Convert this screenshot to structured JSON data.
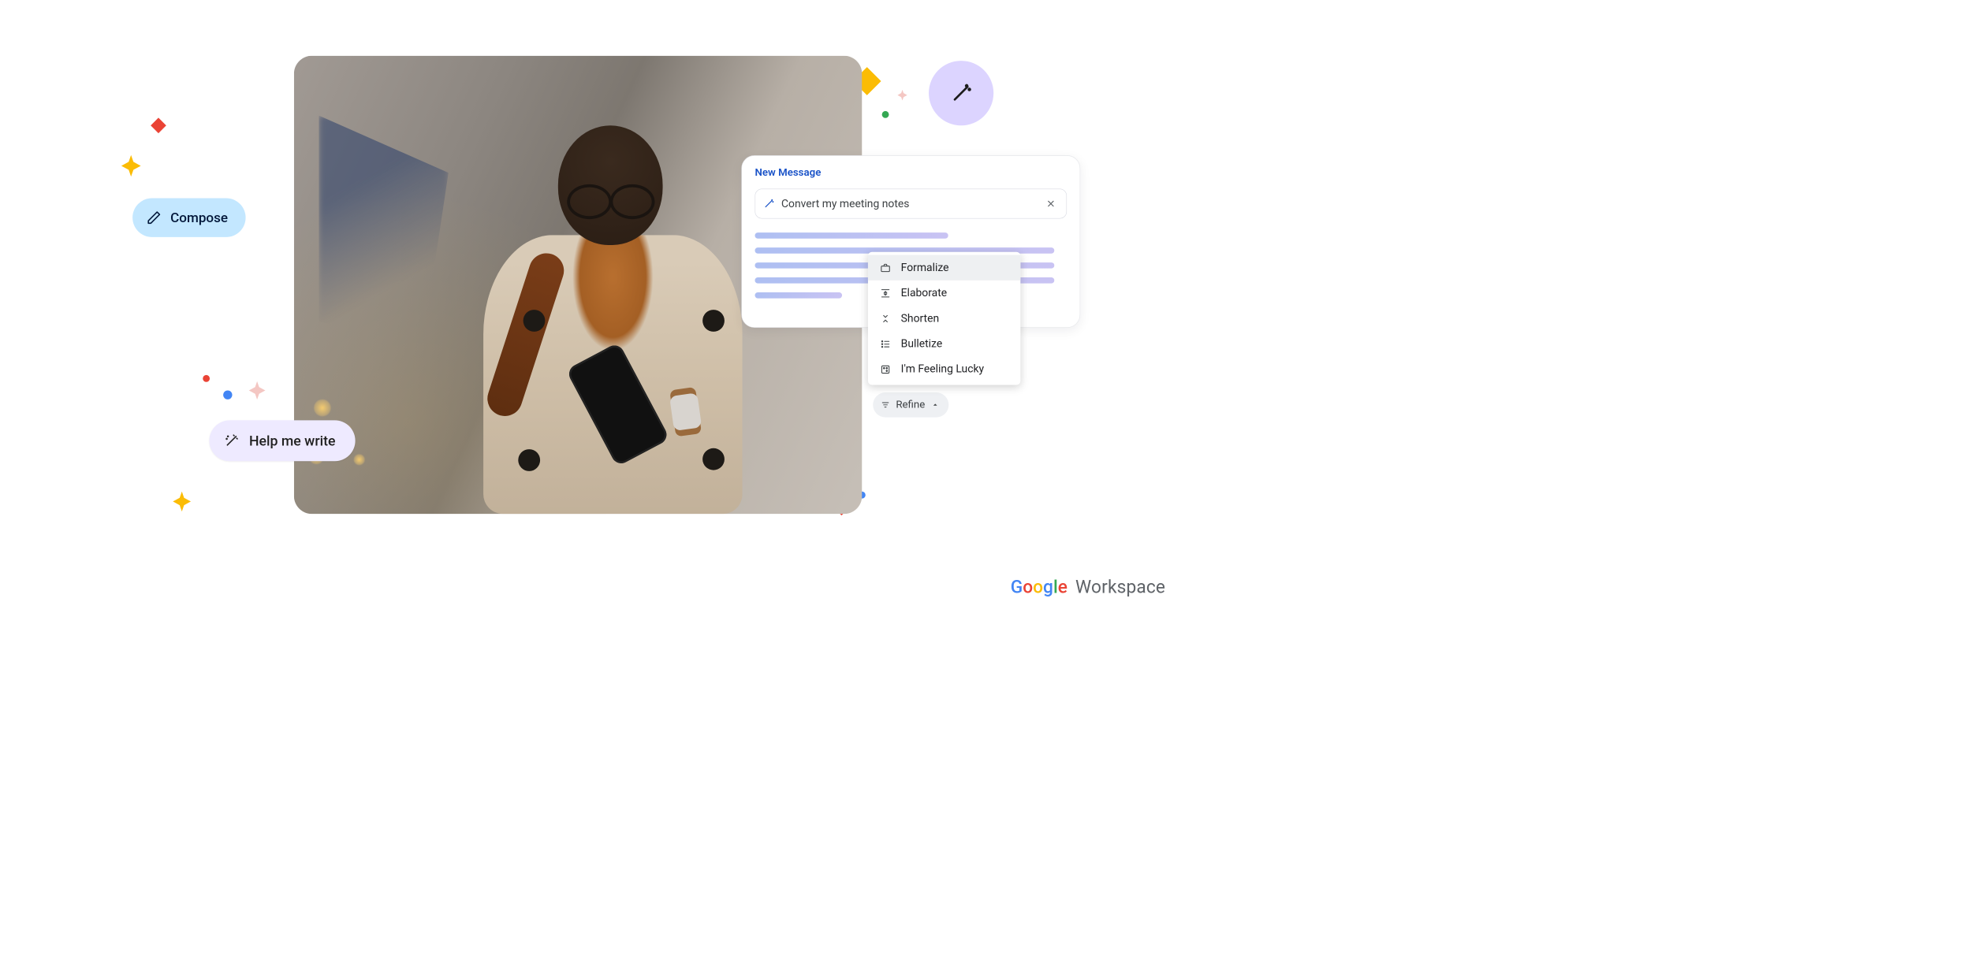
{
  "compose": {
    "label": "Compose"
  },
  "help_me_write": {
    "label": "Help me write"
  },
  "new_message": {
    "title": "New Message",
    "prompt": "Convert my meeting notes"
  },
  "menu": {
    "items": [
      {
        "id": "formalize",
        "label": "Formalize",
        "selected": true
      },
      {
        "id": "elaborate",
        "label": "Elaborate",
        "selected": false
      },
      {
        "id": "shorten",
        "label": "Shorten",
        "selected": false
      },
      {
        "id": "bulletize",
        "label": "Bulletize",
        "selected": false
      },
      {
        "id": "lucky",
        "label": "I'm Feeling Lucky",
        "selected": false
      }
    ]
  },
  "refine": {
    "label": "Refine"
  },
  "footer": {
    "google": "Google",
    "workspace": "Workspace"
  }
}
